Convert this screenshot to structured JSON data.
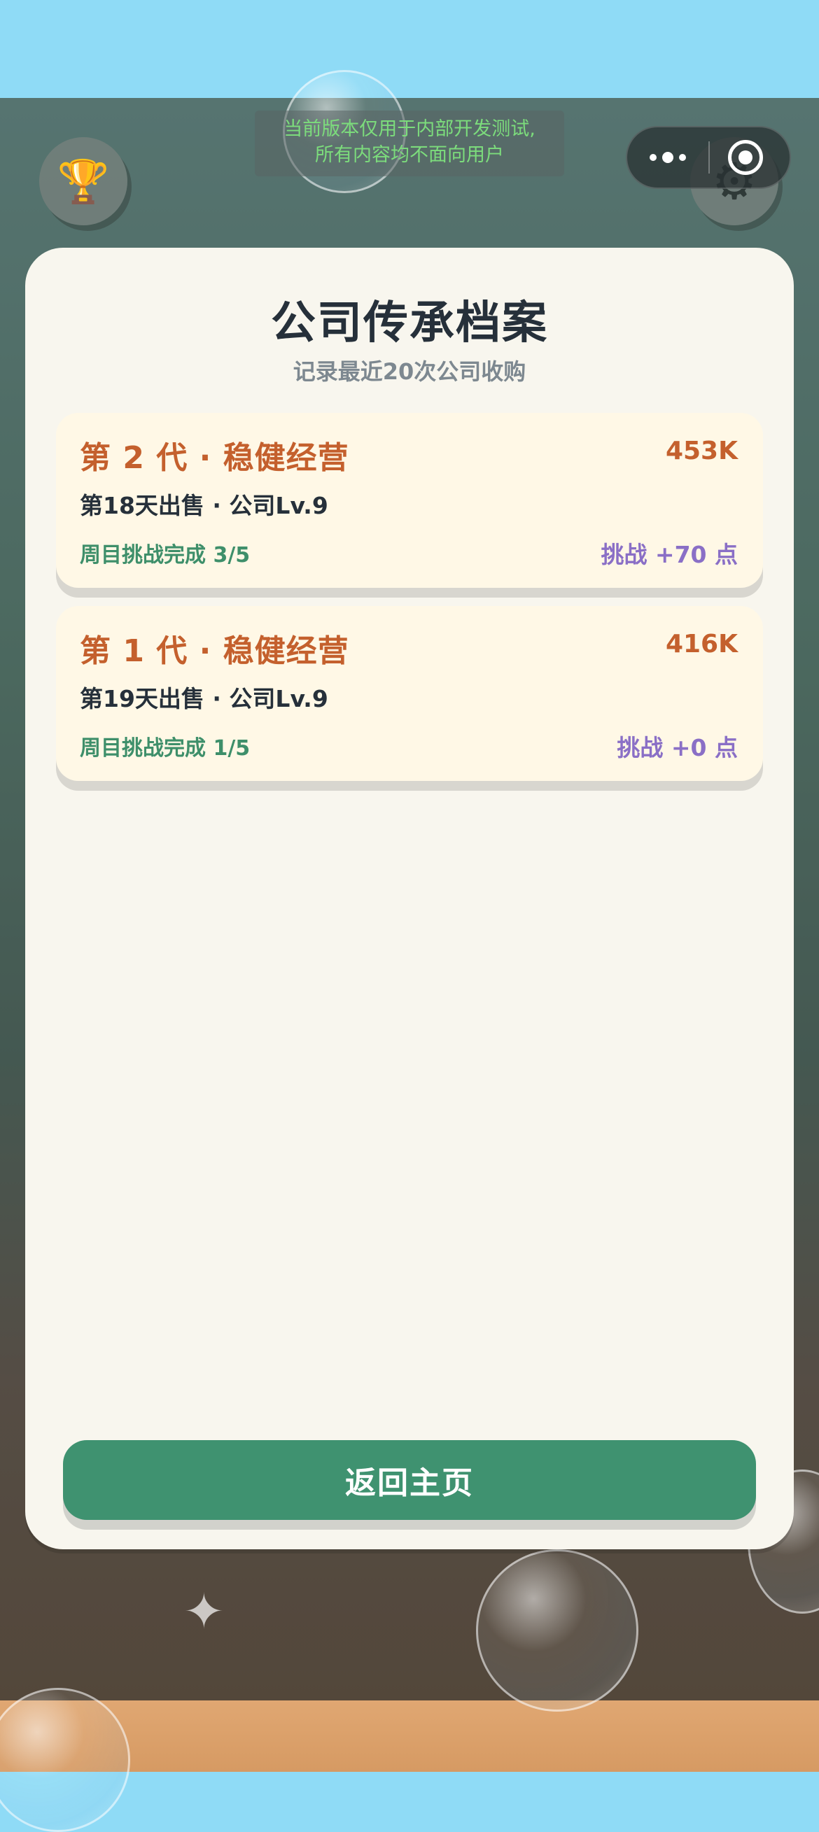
{
  "notice": {
    "line1": "当前版本仅用于内部开发测试,",
    "line2": "所有内容均不面向用户"
  },
  "icons": {
    "trophy": "trophy-icon",
    "settings": "gear-icon",
    "more": "more-dots-icon",
    "close": "miniprogram-close-icon"
  },
  "panel": {
    "title": "公司传承档案",
    "subtitle": "记录最近20次公司收购"
  },
  "records": [
    {
      "title": "第 2 代 · 稳健经营",
      "value": "453K",
      "meta": "第18天出售 · 公司Lv.9",
      "progress": "周目挑战完成 3/5",
      "points": "挑战 +70 点"
    },
    {
      "title": "第 1 代 · 稳健经营",
      "value": "416K",
      "meta": "第19天出售 · 公司Lv.9",
      "progress": "周目挑战完成 1/5",
      "points": "挑战 +0 点"
    }
  ],
  "buttons": {
    "home": "返回主页"
  },
  "colors": {
    "accent_orange": "#c4602d",
    "accent_green": "#3f9270",
    "accent_purple": "#8a6fc6",
    "panel_bg": "#f8f6ee",
    "card_bg": "#fff8e6",
    "notice_text": "#7cdc7c"
  }
}
